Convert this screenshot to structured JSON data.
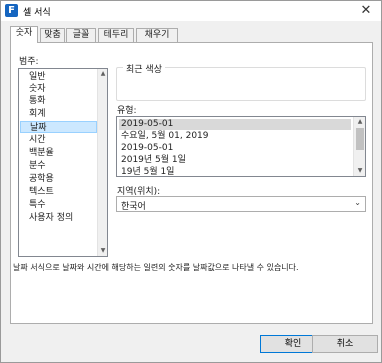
{
  "window": {
    "title": "셀 서식",
    "app_icon_letter": "F",
    "close_glyph": "✕"
  },
  "tabs": [
    {
      "label": "숫자",
      "active": true
    },
    {
      "label": "맞춤",
      "active": false
    },
    {
      "label": "글꼴",
      "active": false
    },
    {
      "label": "테두리",
      "active": false
    },
    {
      "label": "채우기",
      "active": false
    }
  ],
  "category": {
    "label": "범주:",
    "items": [
      "일반",
      "숫자",
      "통화",
      "회계",
      "날짜",
      "시간",
      "백분율",
      "분수",
      "공학용",
      "텍스트",
      "특수",
      "사용자 정의"
    ],
    "selected_index": 4
  },
  "sample": {
    "legend": "최근 색상",
    "value": ""
  },
  "type": {
    "label": "유형:",
    "items": [
      "2019-05-01",
      "수요일, 5월 01, 2019",
      "2019-05-01",
      "2019년 5월 1일",
      "19년 5월 1일"
    ],
    "selected_index": 0
  },
  "locale": {
    "label": "지역(위치):",
    "value": "한국어"
  },
  "description": "날짜 서식으로 날짜와 시간에 해당하는 일련의 숫자를 날짜값으로 나타낼 수 있습니다.",
  "buttons": {
    "ok": "확인",
    "cancel": "취소"
  },
  "icons": {
    "scroll_up": "▲",
    "scroll_down": "▼",
    "dropdown": "⌄"
  }
}
